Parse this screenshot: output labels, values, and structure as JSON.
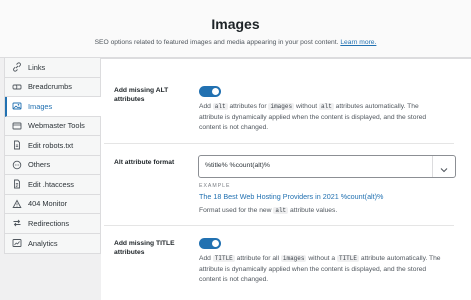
{
  "header": {
    "title": "Images",
    "subtitle": "SEO options related to featured images and media appearing in your post content.",
    "learn_more": "Learn more."
  },
  "sidebar": {
    "items": [
      {
        "label": "Links",
        "icon": "link-icon",
        "active": false
      },
      {
        "label": "Breadcrumbs",
        "icon": "breadcrumbs-icon",
        "active": false
      },
      {
        "label": "Images",
        "icon": "image-icon",
        "active": true
      },
      {
        "label": "Webmaster Tools",
        "icon": "webmaster-tools-icon",
        "active": false
      },
      {
        "label": "Edit robots.txt",
        "icon": "robots-file-icon",
        "active": false
      },
      {
        "label": "Others",
        "icon": "others-icon",
        "active": false
      },
      {
        "label": "Edit .htaccess",
        "icon": "htaccess-file-icon",
        "active": false
      },
      {
        "label": "404 Monitor",
        "icon": "monitor-icon",
        "active": false
      },
      {
        "label": "Redirections",
        "icon": "redirect-icon",
        "active": false
      },
      {
        "label": "Analytics",
        "icon": "analytics-icon",
        "active": false
      }
    ]
  },
  "settings": {
    "alt": {
      "label_line1": "Add missing ALT",
      "label_line2": "attributes",
      "enabled": true,
      "desc_l1_a": "Add",
      "desc_l1_code1": "alt",
      "desc_l1_b": "attributes for",
      "desc_l1_code2": "images",
      "desc_l1_c": "without",
      "desc_l1_code3": "alt",
      "desc_l1_d": "attributes automatically. The",
      "desc_l2": "attribute is dynamically applied when the content is displayed, and the stored",
      "desc_l3": "content is not changed."
    },
    "alt_format": {
      "label": "Alt attribute format",
      "value": "%title% %count(alt)%",
      "example_label": "EXAMPLE",
      "example_value": "The 18 Best Web Hosting Providers in 2021 %count(alt)%",
      "hint_a": "Format used for the new",
      "hint_code": "alt",
      "hint_b": "attribute values."
    },
    "title_attr": {
      "label_line1": "Add missing TITLE",
      "label_line2": "attributes",
      "enabled": true,
      "desc_l1_a": "Add",
      "desc_l1_code1": "TITLE",
      "desc_l1_b": "attribute for all",
      "desc_l1_code2": "images",
      "desc_l1_c": "without a",
      "desc_l1_code3": "TITLE",
      "desc_l1_d": "attribute automatically. The",
      "desc_l2": "attribute is dynamically applied when the content is displayed, and the stored",
      "desc_l3": "content is not changed."
    }
  },
  "colors": {
    "accent": "#2271b1",
    "text": "#1d2327",
    "muted": "#50575e"
  }
}
